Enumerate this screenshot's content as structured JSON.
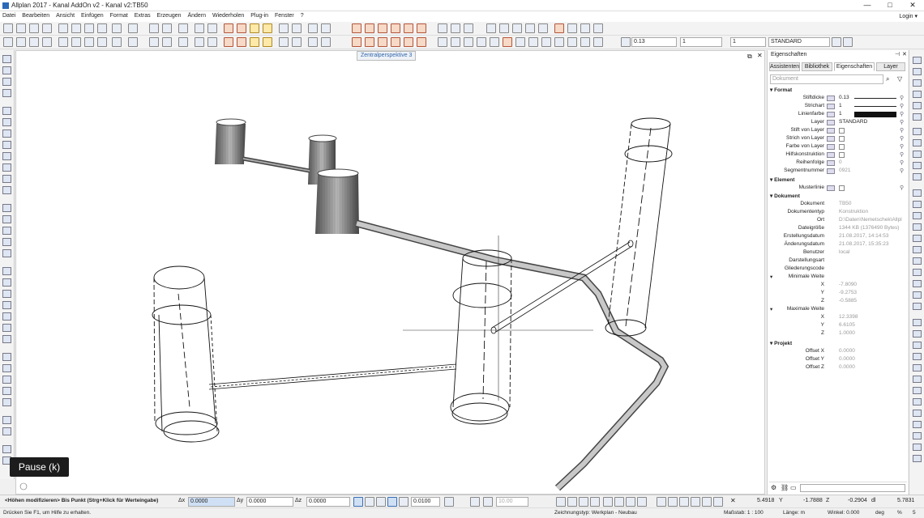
{
  "window": {
    "title": "Allplan 2017 - Kanal AddOn v2 - Kanal v2:TB50",
    "minimize": "—",
    "maximize": "□",
    "close": "✕"
  },
  "menu": [
    "Datei",
    "Bearbeiten",
    "Ansicht",
    "Einfügen",
    "Format",
    "Extras",
    "Erzeugen",
    "Ändern",
    "Wiederholen",
    "Plug-in",
    "Fenster",
    "?"
  ],
  "login": "Login ▾",
  "format_bar": {
    "pen": "0.13",
    "line": "1",
    "color": "1",
    "layer": "STANDARD"
  },
  "viewport": {
    "tab": "Zentralperspektive 3"
  },
  "panel": {
    "title": "Eigenschaften",
    "tabs": [
      "Assistenten",
      "Bibliothek",
      "Eigenschaften",
      "Layer"
    ],
    "doc_select": "Dokument",
    "sections": {
      "format": "Format",
      "element": "Element",
      "dokument": "Dokument",
      "minweite": "Minimale Weite",
      "maxweite": "Maximale Weite",
      "projekt": "Projekt"
    },
    "format_rows": [
      {
        "label": "Stiftdicke",
        "value": "0.13"
      },
      {
        "label": "Strichart",
        "value": "1"
      },
      {
        "label": "Linienfarbe",
        "value": "1"
      },
      {
        "label": "Layer",
        "value": "STANDARD"
      },
      {
        "label": "Stift von Layer",
        "value": ""
      },
      {
        "label": "Strich von Layer",
        "value": ""
      },
      {
        "label": "Farbe von Layer",
        "value": ""
      },
      {
        "label": "Hilfskonstruktion",
        "value": ""
      },
      {
        "label": "Reihenfolge",
        "value": "0"
      },
      {
        "label": "Segmentnummer",
        "value": "0921"
      }
    ],
    "element_rows": [
      {
        "label": "Musterlinie",
        "value": ""
      }
    ],
    "dokument_rows": [
      {
        "label": "Dokument",
        "value": "TB50"
      },
      {
        "label": "Dokumententyp",
        "value": "Konstruktion"
      },
      {
        "label": "Ort",
        "value": "D:\\Daten\\Nemetschek\\Allpl"
      },
      {
        "label": "Dateigröße",
        "value": "1344 KB (1376490 Bytes)"
      },
      {
        "label": "Erstellungsdatum",
        "value": "21.08.2017, 14:14:53"
      },
      {
        "label": "Änderungsdatum",
        "value": "21.08.2017, 15:35:23"
      },
      {
        "label": "Benutzer",
        "value": "local"
      },
      {
        "label": "Darstellungsart",
        "value": ""
      },
      {
        "label": "Gliederungscode",
        "value": ""
      }
    ],
    "min_rows": [
      {
        "label": "X",
        "value": "-7.8090"
      },
      {
        "label": "Y",
        "value": "-9.2753"
      },
      {
        "label": "Z",
        "value": "-0.5885"
      }
    ],
    "max_rows": [
      {
        "label": "X",
        "value": "12.3398"
      },
      {
        "label": "Y",
        "value": "6.6105"
      },
      {
        "label": "Z",
        "value": "1.0000"
      }
    ],
    "projekt_rows": [
      {
        "label": "Offset X",
        "value": "0.0000"
      },
      {
        "label": "Offset Y",
        "value": "0.0000"
      },
      {
        "label": "Offset Z",
        "value": "0.0000"
      }
    ]
  },
  "pause": "Pause (k)",
  "cmd": {
    "prompt": "<Höhen modifizieren> Bis Punkt  (Strg+Klick für Werteingabe)",
    "dx_label": "Δx",
    "dx": "0.0000",
    "dy_label": "Δy",
    "dy": "0.0000",
    "dz_label": "Δz",
    "dz": "0.0000",
    "step": "0.0100",
    "angle": "10.00",
    "x": "5.4918",
    "y": "-1.7888",
    "z": "-0.2904",
    "dl": "5.7831",
    "y_label": "Y",
    "z_label": "Z",
    "dl_label": "dl"
  },
  "status": {
    "hint": "Drücken Sie F1, um Hilfe zu erhalten.",
    "drawing_type": "Zeichnungstyp: Werkplan - Neubau",
    "scale": "Maßstab: 1 : 100",
    "length": "Länge:  m",
    "angle": "Winkel:  0.000",
    "deg": "deg",
    "percent": "%",
    "percent_val": "5"
  },
  "icons": [
    "file-icon",
    "folder-icon",
    "save-icon",
    "cut-icon",
    "copy-icon",
    "undo-icon",
    "redo-icon",
    "line-icon",
    "polyline-icon",
    "rectangle-icon",
    "circle-icon",
    "pin-icon",
    "search-icon",
    "filter-icon",
    "close-icon"
  ]
}
